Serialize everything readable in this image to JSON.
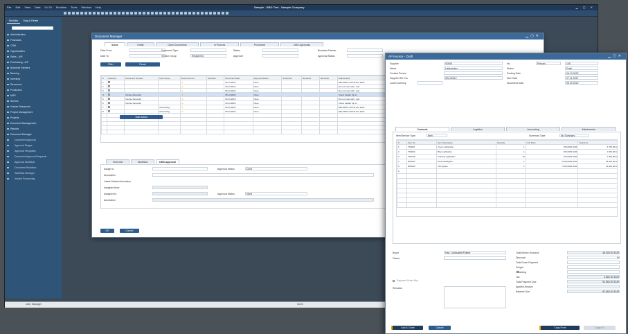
{
  "app": {
    "title": "Sample - SBO Test - Sample Company",
    "menu": [
      "File",
      "Edit",
      "View",
      "Data",
      "Go To",
      "Modules",
      "Tools",
      "Window",
      "Help"
    ],
    "sidebar_tabs": [
      "Modules",
      "Drag & Relate"
    ],
    "sidebar_items": [
      "Administration",
      "Financials",
      "CRM",
      "Opportunities",
      "Sales - A/R",
      "Purchasing - A/P",
      "Business Partners",
      "Banking",
      "Inventory",
      "Resources",
      "Production",
      "MRP",
      "Service",
      "Human Resources",
      "Project Management",
      "Projects",
      "Document Management",
      "Reports",
      "Document Manager",
      "Document Approval",
      "Approval Stages",
      "Approval Templates",
      "Document Approval Requests",
      "Approval Workflow",
      "Document Workflow",
      "Workflow Manager",
      "Invoice Processing"
    ],
    "sidebar_sub_from": 19,
    "status_left": "User: Manager",
    "status_center": "16:22"
  },
  "dm": {
    "title": "Document Manager",
    "tabs": [
      "Inbox",
      "Drafts",
      "Open Documents",
      "In Process",
      "Processed",
      "DMS Approvals"
    ],
    "filter_labels": [
      "Date From",
      "Date To",
      "Document Type",
      "Vendor Group",
      "Status",
      "Approver",
      "Business Partner",
      "Approval Status"
    ],
    "dropdown_value": "Registered",
    "buttons": {
      "filter": "Filter",
      "reset": "Reset",
      "ok": "OK",
      "cancel": "Cancel",
      "take_action": "Take Action"
    },
    "columns": [
      "#",
      "Selected",
      "Document Number",
      "User Group",
      "Document No.",
      "Revision",
      "Document Date",
      "Approval Status",
      "Authorizer",
      "Remarks",
      "Remarks",
      "Attachments"
    ],
    "rows": [
      [
        "1",
        "",
        "",
        "",
        "",
        "",
        "05.10.2022",
        "None",
        "",
        "",
        "",
        "DELIVERY NOTE Nov 2022"
      ],
      [
        "2",
        "",
        "",
        "",
        "",
        "",
        "05.10.2022",
        "None",
        "",
        "",
        "",
        "Do not mess with - last"
      ],
      [
        "3",
        "",
        "",
        "",
        "",
        "",
        "05.10.2022",
        "None",
        "",
        "",
        "",
        "Do not mess with - last"
      ],
      [
        "4",
        "",
        "Denise Devonish",
        "",
        "",
        "",
        "05.10.2022",
        "None",
        "",
        "",
        "",
        "Invest Ladder trip to"
      ],
      [
        "5",
        "",
        "Denise Devonish",
        "",
        "",
        "",
        "05.10.2022",
        "None",
        "",
        "",
        "",
        "Do not mess with - last"
      ],
      [
        "6",
        "",
        "Denise Devonish",
        "",
        "",
        "",
        "05.10.2022",
        "None",
        "",
        "",
        "",
        "Invest Ladder trip to"
      ],
      [
        "7",
        "",
        "",
        "Accounting",
        "",
        "",
        "05.10.2022",
        "None",
        "",
        "",
        "",
        "DELIVERY NOTE Nov 2022"
      ],
      [
        "8",
        "",
        "",
        "Accounting",
        "",
        "",
        "05.10.2022",
        "None",
        "",
        "",
        "",
        "DELIVERY NOTE Nov 2022"
      ]
    ],
    "subtabs": [
      "Overview",
      "Workflow",
      "DMS Approval"
    ],
    "approval_labels": [
      "Assign to",
      "Annotation",
      "Latest Status Information",
      "Assigned from",
      "Assigned to",
      "Annotation"
    ],
    "approval_right": [
      "Approval Status",
      "Approval Status"
    ],
    "approval_values": [
      "Done",
      "None"
    ]
  },
  "ap": {
    "title": "AP Invoice - Draft",
    "head_labels": [
      "Supplier",
      "Name",
      "Contact Person",
      "Supplier Ref. No.",
      "Local Currency"
    ],
    "head_values": [
      "V0005",
      "Lieferanten",
      "",
      "INV-00012",
      ""
    ],
    "right_labels": [
      "No.",
      "Status",
      "Posting Date",
      "Due Date",
      "Document Date"
    ],
    "right_values": [
      "145",
      "Draft",
      "05.10.2022",
      "07.11.2022",
      "05.10.2022"
    ],
    "series": "Primary",
    "tabs": [
      "Contents",
      "Logistics",
      "Accounting",
      "Attachments"
    ],
    "item_type_label": "Item/Service Type",
    "item_type": "Item",
    "summary_label": "Summary Type",
    "summary": "No Summary",
    "columns": [
      "#",
      "Item No.",
      "Item Description",
      "Quantity",
      "Unit Price",
      "Total (LC)"
    ],
    "rows": [
      [
        "1",
        "TS0001",
        "Green Lightsaber",
        "1",
        "150,0000 EUR",
        "3.750,00 E"
      ],
      [
        "2",
        "TS0002",
        "Blue Lightsaber",
        "1",
        "150,0000 EUR",
        "1.500,00 E"
      ],
      [
        "3",
        "TS0725",
        "Training Lightsaber",
        "10",
        "100,0000 EUR",
        "1.000,00 E"
      ],
      [
        "4",
        "BS0012",
        "Droid Starfighter",
        "1",
        "3.000,0000 EUR",
        "18.000,00 E"
      ],
      [
        "5",
        "BS0013",
        "TIE Fighter",
        "1",
        "7.000,0000 EUR",
        "14.000,00 E"
      ],
      [
        "6",
        "",
        "",
        "",
        "",
        ""
      ]
    ],
    "left_labels": [
      "Buyer",
      "Owner",
      "Remarks"
    ],
    "buyer": "Han, Lightsaber/Fighter",
    "payment_label": "Payment Order Run",
    "totals_labels": [
      "Total Before Discount",
      "Discount",
      "Total Down Payment",
      "Freight",
      "Rounding",
      "Tax",
      "Total Payment Due",
      "Applied Amount",
      "Balance Due"
    ],
    "totals_values": [
      "48.000,00 EUR",
      "%",
      "",
      "",
      "",
      "4.560,00 EUR",
      "52.560,00 EUR",
      "",
      "52.560,00 EUR"
    ],
    "buttons": {
      "add_close": "Add & Close",
      "cancel": "Cancel",
      "copy_from": "Copy From",
      "copy_to": "Copy To"
    }
  }
}
